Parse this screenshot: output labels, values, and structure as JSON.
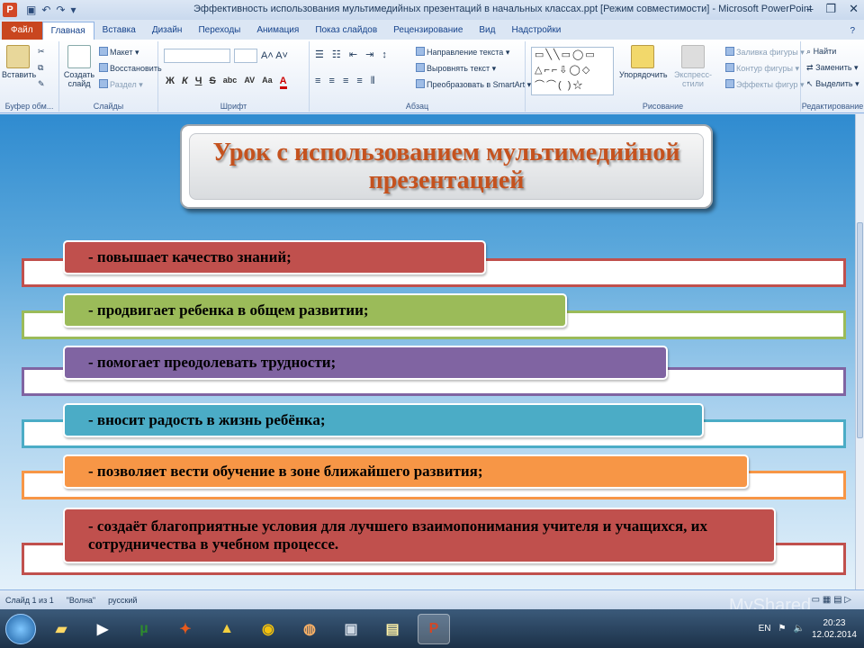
{
  "window": {
    "title": "Эффективность использования мультимедийных презентаций в начальных классах.ppt [Режим совместимости] - Microsoft PowerPoint",
    "app_icon": "P"
  },
  "ribbon_tabs": {
    "file": "Файл",
    "tabs": [
      "Главная",
      "Вставка",
      "Дизайн",
      "Переходы",
      "Анимация",
      "Показ слайдов",
      "Рецензирование",
      "Вид",
      "Надстройки"
    ],
    "active": "Главная"
  },
  "ribbon": {
    "clipboard": {
      "paste": "Вставить",
      "label": "Буфер обм..."
    },
    "slides": {
      "create": "Создать слайд",
      "layout": "Макет",
      "reset": "Восстановить",
      "section": "Раздел",
      "label": "Слайды"
    },
    "font": {
      "label": "Шрифт",
      "bold": "Ж",
      "italic": "К",
      "underline": "Ч",
      "strike": "S",
      "shadow": "abc",
      "spacing": "AV",
      "case": "Aa"
    },
    "paragraph": {
      "text_direction": "Направление текста",
      "align_text": "Выровнять текст",
      "smartart": "Преобразовать в SmartArt",
      "label": "Абзац"
    },
    "drawing": {
      "arrange": "Упорядочить",
      "styles": "Экспресс-стили",
      "fill": "Заливка фигуры",
      "outline": "Контур фигуры",
      "effects": "Эффекты фигур",
      "label": "Рисование"
    },
    "editing": {
      "find": "Найти",
      "replace": "Заменить",
      "select": "Выделить",
      "label": "Редактирование"
    }
  },
  "slide": {
    "title": "Урок с использованием мультимедийной презентацией",
    "items": [
      {
        "text": "- повышает качество знаний;",
        "color": "#c0504d",
        "border": "#c0504d"
      },
      {
        "text": "- продвигает ребенка в общем развитии;",
        "color": "#9bbb59",
        "border": "#9bbb59"
      },
      {
        "text": "- помогает преодолевать трудности;",
        "color": "#8064a2",
        "border": "#8064a2"
      },
      {
        "text": "- вносит радость в жизнь ребёнка;",
        "color": "#4bacc6",
        "border": "#4bacc6"
      },
      {
        "text": "- позволяет вести обучение в зоне ближайшего развития;",
        "color": "#f79646",
        "border": "#f79646"
      },
      {
        "text": "- создаёт благоприятные условия для лучшего взаимопонимания учителя и учащихся, их сотрудничества в учебном процессе.",
        "color": "#c0504d",
        "border": "#c0504d"
      }
    ]
  },
  "statusbar": {
    "slide": "Слайд 1 из 1",
    "theme": "\"Волна\"",
    "language": "русский"
  },
  "taskbar": {
    "language": "EN",
    "time": "20:23",
    "date": "12.02.2014"
  },
  "watermark": "MyShared"
}
